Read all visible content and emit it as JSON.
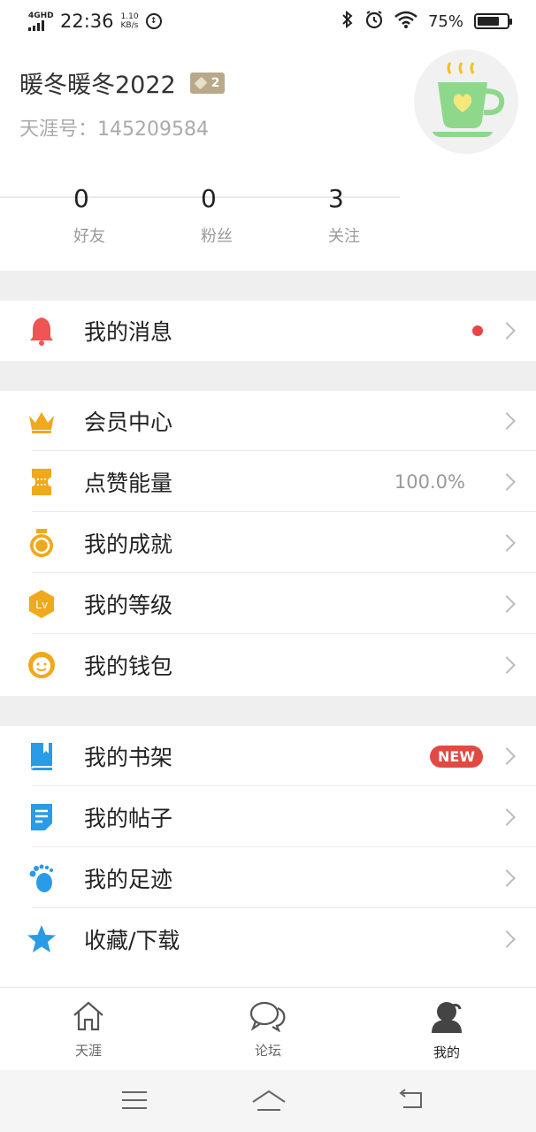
{
  "status_bar": {
    "network": "4GHD",
    "time": "22:36",
    "speed_value": "1.10",
    "speed_unit": "KB/s",
    "battery": "75%",
    "battery_level": 0.75
  },
  "profile": {
    "username": "暖冬暖冬2022",
    "level": "2",
    "uid": "天涯号：145209584"
  },
  "stats": [
    {
      "count": "0",
      "label": "好友"
    },
    {
      "count": "0",
      "label": "粉丝"
    },
    {
      "count": "3",
      "label": "关注"
    }
  ],
  "menu": {
    "messages": {
      "label": "我的消息"
    },
    "vip": {
      "label": "会员中心"
    },
    "likes_energy": {
      "label": "点赞能量",
      "value": "100.0%"
    },
    "achievements": {
      "label": "我的成就"
    },
    "level": {
      "label": "我的等级",
      "icon_text": "Lv"
    },
    "wallet": {
      "label": "我的钱包"
    },
    "bookshelf": {
      "label": "我的书架",
      "badge": "NEW"
    },
    "posts": {
      "label": "我的帖子"
    },
    "footprints": {
      "label": "我的足迹"
    },
    "favorites": {
      "label": "收藏/下载"
    }
  },
  "bottom_nav": [
    {
      "label": "天涯",
      "icon": "home-icon"
    },
    {
      "label": "论坛",
      "icon": "chat-icon"
    },
    {
      "label": "我的",
      "icon": "profile-icon"
    }
  ],
  "colors": {
    "red": "#e84545",
    "gold": "#f0a81c",
    "blue": "#2a9be6",
    "gray_text": "#999999"
  }
}
